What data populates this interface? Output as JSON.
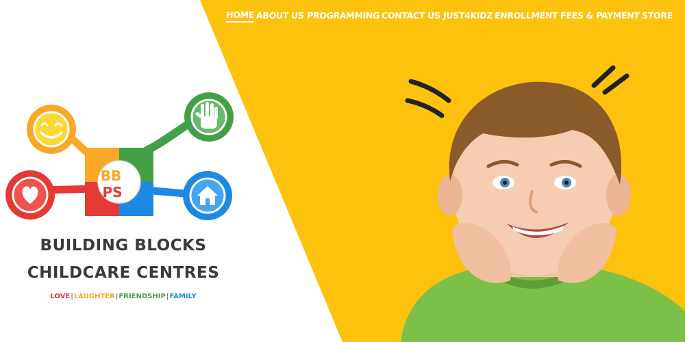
{
  "nav": {
    "items": [
      {
        "label": "HOME",
        "active": true
      },
      {
        "label": "ABOUT US"
      },
      {
        "label": "PROGRAMMING"
      },
      {
        "label": "CONTACT US"
      },
      {
        "label": "JUST4KIDZ"
      },
      {
        "label": "ENROLLMENT"
      },
      {
        "label": "FEES & PAYMENT"
      },
      {
        "label": "STORE"
      }
    ]
  },
  "logo": {
    "monogram_line1": "BB",
    "monogram_line2": "PS",
    "title_line1": "BUILDING BLOCKS",
    "title_line2": "CHILDCARE CENTRES",
    "tagline": [
      "LOVE",
      "LAUGHTER",
      "FRIENDSHIP",
      "FAMILY"
    ],
    "separator": "|",
    "icons": [
      "smiley-icon",
      "hand-icon",
      "heart-icon",
      "house-icon"
    ]
  },
  "hero": {
    "image": "smiling-boy-photo"
  },
  "colors": {
    "accent_yellow": "#FDC20E",
    "text_dark": "#3a3a3a",
    "red": "#E53935",
    "green": "#43A047",
    "blue": "#1E88E5",
    "orange": "#F9A825",
    "tag_love": "#E53935",
    "tag_laughter": "#F9A825",
    "tag_friendship": "#43A047",
    "tag_family": "#1E88E5"
  }
}
